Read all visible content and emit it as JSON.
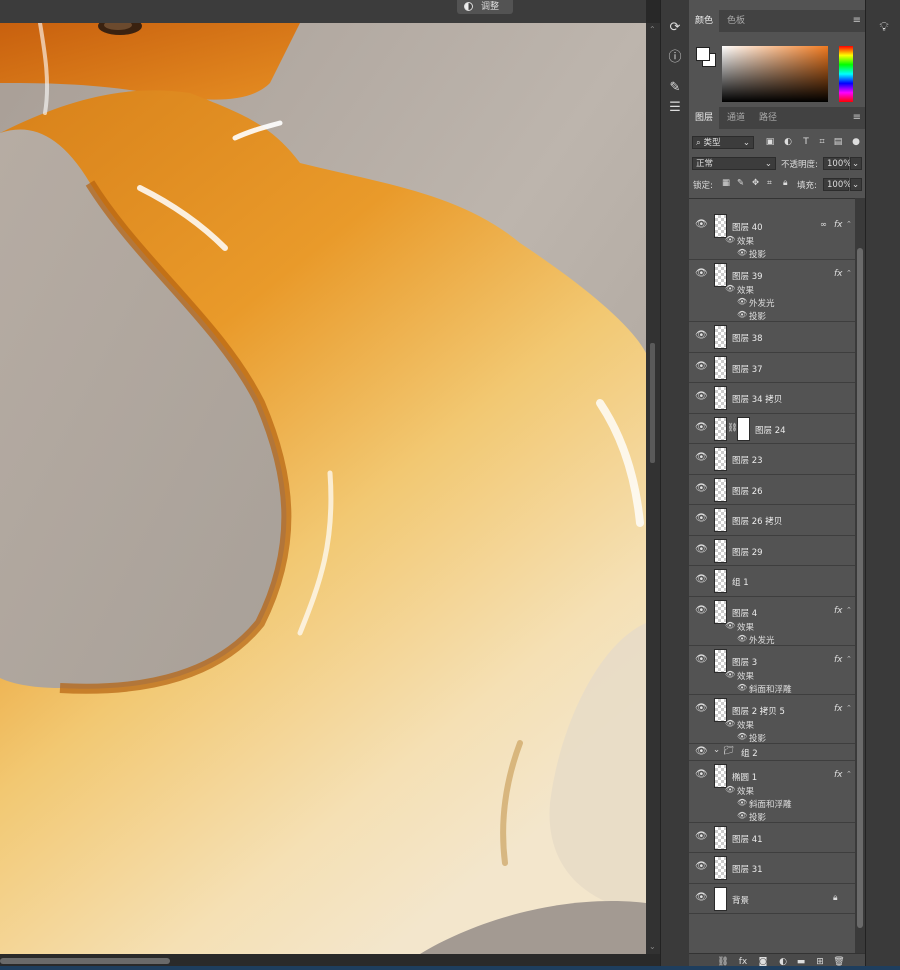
{
  "topbar": {
    "adjust_tab": "调整"
  },
  "color_panel": {
    "tabs": [
      "颜色",
      "色板"
    ],
    "foreground": "#ffffff",
    "background": "#ffffff",
    "hue_color": "#f07a20"
  },
  "layers_panel": {
    "tabs": [
      "图层",
      "通道",
      "路径"
    ],
    "filter_kind": "类型",
    "blend_mode": "正常",
    "opacity_label": "不透明度:",
    "opacity_value": "100%",
    "lock_label": "锁定:",
    "fill_label": "填充:",
    "fill_value": "100%",
    "layers": [
      {
        "name": "图层 40",
        "fx": true,
        "link": true,
        "effects_label": "效果",
        "effects": [
          "投影"
        ]
      },
      {
        "name": "图层 39",
        "fx": true,
        "effects_label": "效果",
        "effects": [
          "外发光",
          "投影"
        ]
      },
      {
        "name": "图层 38"
      },
      {
        "name": "图层 37"
      },
      {
        "name": "图层 34 拷贝"
      },
      {
        "name": "图层 24",
        "mask": true
      },
      {
        "name": "图层 23"
      },
      {
        "name": "图层 26"
      },
      {
        "name": "图层 26 拷贝"
      },
      {
        "name": "图层 29"
      },
      {
        "name": "组 1"
      },
      {
        "name": "图层 4",
        "fx": true,
        "effects_label": "效果",
        "effects": [
          "外发光"
        ]
      },
      {
        "name": "图层 3",
        "fx": true,
        "effects_label": "效果",
        "effects": [
          "斜面和浮雕"
        ]
      },
      {
        "name": "图层 2 拷贝 5",
        "fx": true,
        "effects_label": "效果",
        "effects": [
          "投影"
        ]
      },
      {
        "name": "组 2",
        "group": true
      },
      {
        "name": "椭圆 1",
        "fx": true,
        "effects_label": "效果",
        "effects": [
          "斜面和浮雕",
          "投影"
        ]
      },
      {
        "name": "图层 41"
      },
      {
        "name": "图层 31"
      },
      {
        "name": "背景",
        "locked": true
      }
    ]
  },
  "icons": {
    "eye": "eye-icon",
    "fx": "fx",
    "lock": "lock-icon"
  }
}
